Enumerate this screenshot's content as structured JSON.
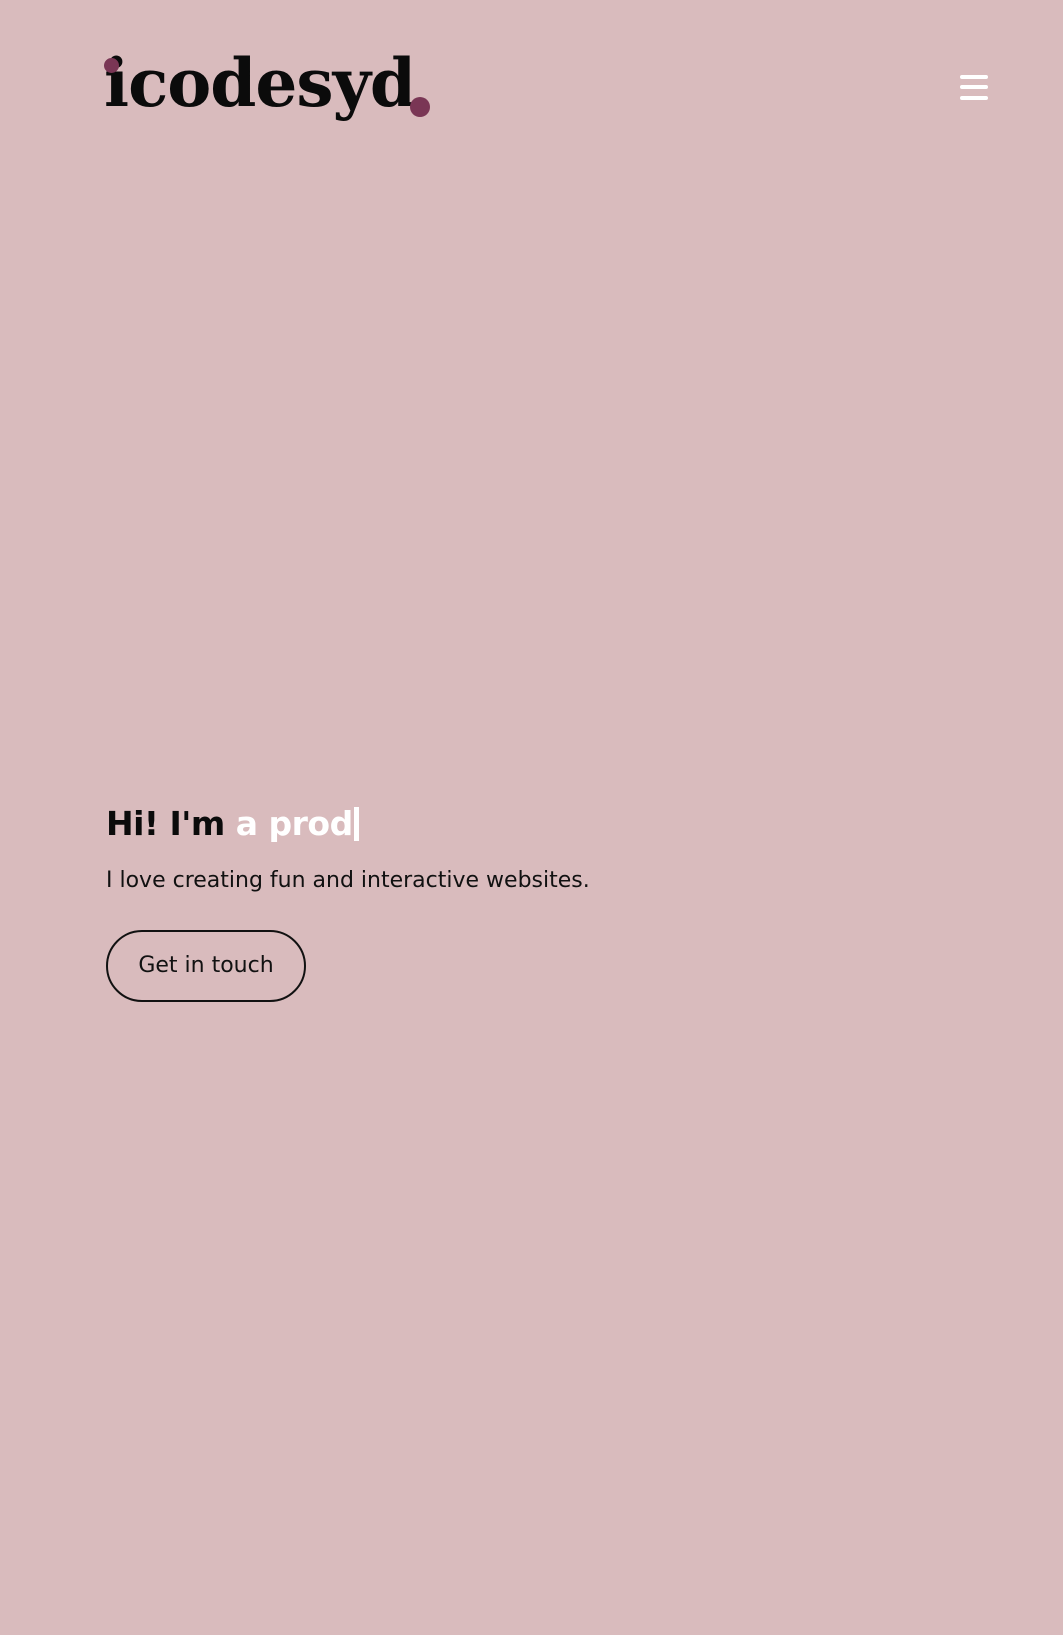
{
  "header": {
    "logo_text": "icodesyd",
    "menu_icon": "hamburger-menu-icon"
  },
  "hero": {
    "greeting": "Hi! I'm",
    "typed_text": "a prod",
    "subtitle": "I love creating fun and interactive websites.",
    "cta_label": "Get in touch"
  },
  "colors": {
    "background": "#d9bbbd",
    "accent": "#7a3655",
    "text": "#0b0b0b",
    "highlight": "#ffffff"
  }
}
